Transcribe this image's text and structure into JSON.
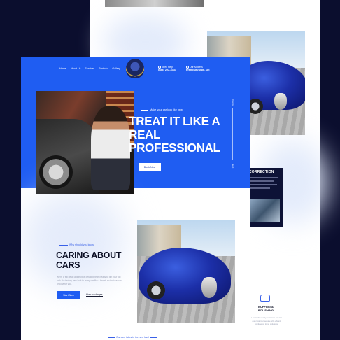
{
  "nav": {
    "items": [
      "Home",
      "About Us",
      "Services",
      "Portfolio",
      "Gallery"
    ]
  },
  "brand": {
    "logo_text": "LUXURY DETAILING"
  },
  "contact": {
    "phone_label": "Need Help",
    "phone": "(888) 222-3333",
    "address_label": "Our Address",
    "address": "Frankfurt/Main, DE"
  },
  "hero": {
    "tagline": "Make your car look like new",
    "title": "TREAT IT LIKE A REAL PROFESSIONAL",
    "button": "Book Now",
    "side_top": "Interior",
    "side_bottom": "Next"
  },
  "about": {
    "eyebrow": "Why should you know",
    "title": "CARING ABOUT CARS",
    "paragraph": "We're a full detail automotive detailing team ready to get your old look like factory new look to every car like a brand, so that we can choose for you.",
    "start_button": "Start Now",
    "packages_link": "How packages"
  },
  "correction": {
    "title": "CORRECTION"
  },
  "buffing": {
    "title": "BUFFING & POLISHING",
    "text": "Lorem absolutely culminate one for our customer service with vibrant conference trend solutions."
  },
  "footer": {
    "tagline": "Our care takes to the next level"
  },
  "colors": {
    "primary": "#1f5df2",
    "dark": "#0b0e2e",
    "accent_text": "#3a61e8"
  }
}
